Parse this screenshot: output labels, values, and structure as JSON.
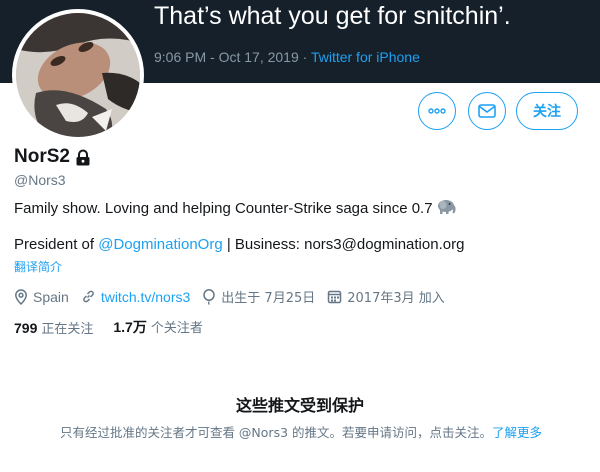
{
  "banner": {
    "quote": "That’s what you get for snitchin’.",
    "timestamp": "9:06 PM - Oct 17, 2019 · ",
    "source": "Twitter for iPhone"
  },
  "profile": {
    "display_name": "NorS2",
    "handle": "@Nors3",
    "bio_line1": "Family show. Loving and helping Counter-Strike saga since 0.7",
    "bio_line2_prefix": "President of ",
    "bio_mention": "@DogminationOrg",
    "bio_line2_suffix": " | Business: nors3@dogmination.org",
    "translate": "翻译简介",
    "location": "Spain",
    "website": "twitch.tv/nors3",
    "birthday": "出生于 7月25日",
    "joined": "2017年3月 加入"
  },
  "actions": {
    "follow_label": "关注"
  },
  "stats": {
    "following_count": "799",
    "following_label": "正在关注",
    "followers_count": "1.7万",
    "followers_label": "个关注者"
  },
  "protected": {
    "title": "这些推文受到保护",
    "desc_prefix": "只有经过批准的关注者才可查看 @Nors3 的推文。若要申请访问，点击关注。",
    "learn_more": "了解更多"
  },
  "icons": {
    "lock": "lock-icon",
    "elephant": "elephant-emoji-icon",
    "location": "location-pin-icon",
    "link": "link-icon",
    "birthday": "balloon-icon",
    "calendar": "calendar-icon",
    "more": "more-dots-icon",
    "message": "envelope-icon"
  },
  "colors": {
    "accent": "#1da1f2",
    "text": "#14171a",
    "secondary": "#657786",
    "banner_bg": "#15202b"
  }
}
